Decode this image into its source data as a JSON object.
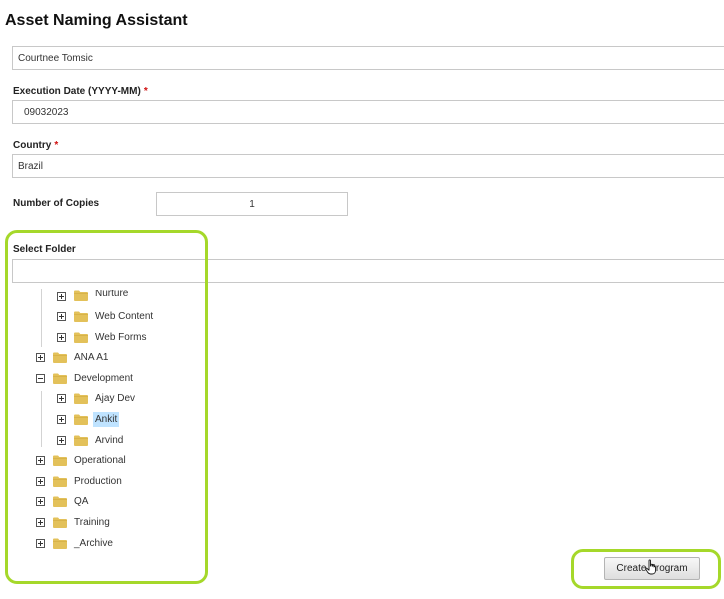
{
  "app": {
    "title": "Asset Naming Assistant"
  },
  "form": {
    "owner_value": "Courtnee Tomsic",
    "execution_date": {
      "label": "Execution Date (YYYY-MM)",
      "required_mark": "*",
      "value": "09032023"
    },
    "country": {
      "label": "Country",
      "required_mark": "*",
      "value": "Brazil"
    },
    "copies": {
      "label": "Number of Copies",
      "value": "1"
    },
    "folder": {
      "label": "Select Folder",
      "filter_value": ""
    }
  },
  "tree": {
    "nodes": [
      {
        "label": "Nurture",
        "expander": "plus"
      },
      {
        "label": "Web Content",
        "expander": "plus"
      },
      {
        "label": "Web Forms",
        "expander": "plus"
      },
      {
        "label": "ANA A1",
        "expander": "plus"
      },
      {
        "label": "Development",
        "expander": "minus"
      },
      {
        "label": "Ajay Dev",
        "expander": "plus"
      },
      {
        "label": "Ankit",
        "expander": "plus",
        "selected": true
      },
      {
        "label": "Arvind",
        "expander": "plus"
      },
      {
        "label": "Operational",
        "expander": "plus"
      },
      {
        "label": "Production",
        "expander": "plus"
      },
      {
        "label": "QA",
        "expander": "plus"
      },
      {
        "label": "Training",
        "expander": "plus"
      },
      {
        "label": "_Archive",
        "expander": "plus"
      }
    ]
  },
  "actions": {
    "create_label": "Create Program"
  },
  "colors": {
    "highlight": "#a5d82a",
    "folder": "#e3c15a",
    "selected": "#bfe3ff",
    "required": "#d01010"
  },
  "icons": {
    "folder": "folder-icon",
    "expand": "plus-box-icon",
    "collapse": "minus-box-icon",
    "cursor": "hand-pointer-icon"
  }
}
